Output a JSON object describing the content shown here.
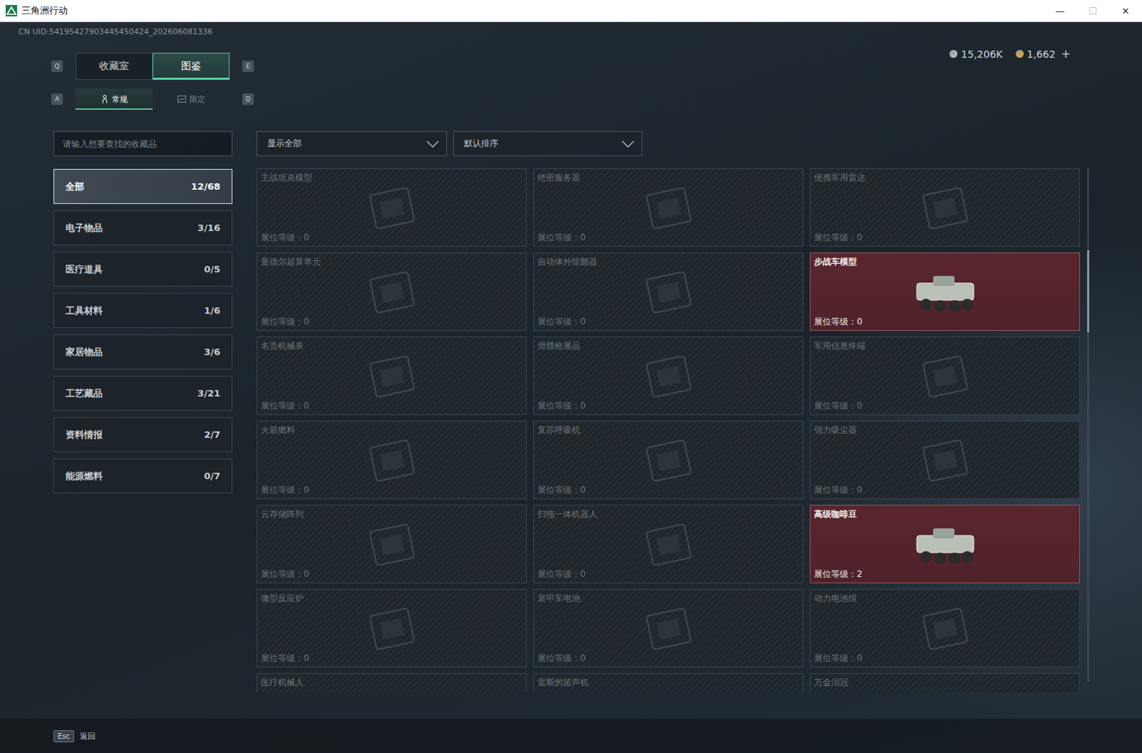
{
  "window": {
    "title": "三角洲行动",
    "controls": [
      "—",
      "☐",
      "✕"
    ]
  },
  "uid": "CN UID:54195427903445450424_202606081336",
  "currency": [
    {
      "amount": "15,206K",
      "color": "#b9bec2"
    },
    {
      "amount": "1,662",
      "color": "#d9a441"
    }
  ],
  "currency_add": "+",
  "tabs": {
    "prev_key": "Q",
    "next_key": "E",
    "items": [
      {
        "label": "收藏室",
        "selected": false
      },
      {
        "label": "图鉴",
        "selected": true
      }
    ]
  },
  "subtabs": {
    "prev_key": "A",
    "next_key": "D",
    "items": [
      {
        "label": "常规",
        "selected": true
      },
      {
        "label": "限定",
        "selected": false
      }
    ]
  },
  "search": {
    "placeholder": "请输入想要查找的收藏品"
  },
  "filters": [
    {
      "label": "显示全部"
    },
    {
      "label": "默认排序"
    }
  ],
  "sidebar": {
    "items": [
      {
        "label": "全部",
        "count": "12/68",
        "selected": true
      },
      {
        "label": "电子物品",
        "count": "3/16",
        "selected": false
      },
      {
        "label": "医疗道具",
        "count": "0/5",
        "selected": false
      },
      {
        "label": "工具材料",
        "count": "1/6",
        "selected": false
      },
      {
        "label": "家居物品",
        "count": "3/6",
        "selected": false
      },
      {
        "label": "工艺藏品",
        "count": "3/21",
        "selected": false
      },
      {
        "label": "资料情报",
        "count": "2/7",
        "selected": false
      },
      {
        "label": "能源燃料",
        "count": "0/7",
        "selected": false
      }
    ]
  },
  "grid": {
    "items": [
      {
        "name": "主战坦克模型",
        "level": "展位等级：0",
        "owned": false
      },
      {
        "name": "绝密服务器",
        "level": "展位等级：0",
        "owned": false
      },
      {
        "name": "便携军用雷达",
        "level": "展位等级：0",
        "owned": false
      },
      {
        "name": "曼德尔超算单元",
        "level": "展位等级：0",
        "owned": false
      },
      {
        "name": "自动体外除颤器",
        "level": "展位等级：0",
        "owned": false
      },
      {
        "name": "步战车模型",
        "level": "展位等级：0",
        "owned": true
      },
      {
        "name": "名贵机械表",
        "level": "展位等级：0",
        "owned": false
      },
      {
        "name": "滑膛枪展品",
        "level": "展位等级：0",
        "owned": false
      },
      {
        "name": "军用信息终端",
        "level": "展位等级：0",
        "owned": false
      },
      {
        "name": "火箭燃料",
        "level": "展位等级：0",
        "owned": false
      },
      {
        "name": "复苏呼吸机",
        "level": "展位等级：0",
        "owned": false
      },
      {
        "name": "强力吸尘器",
        "level": "展位等级：0",
        "owned": false
      },
      {
        "name": "云存储阵列",
        "level": "展位等级：0",
        "owned": false
      },
      {
        "name": "扫拖一体机器人",
        "level": "展位等级：0",
        "owned": false
      },
      {
        "name": "高级咖啡豆",
        "level": "展位等级：2",
        "owned": true
      },
      {
        "name": "微型反应炉",
        "level": "展位等级：0",
        "owned": false
      },
      {
        "name": "装甲车电池",
        "level": "展位等级：0",
        "owned": false
      },
      {
        "name": "动力电池组",
        "level": "展位等级：0",
        "owned": false
      },
      {
        "name": "医疗机械人",
        "owned": false
      },
      {
        "name": "雷斯的留声机",
        "owned": false
      },
      {
        "name": "万金泪冠",
        "owned": false
      }
    ]
  },
  "scrollbar": {
    "position": 0.16,
    "size": 0.16
  },
  "footer": {
    "key": "Esc",
    "label": "返回"
  }
}
